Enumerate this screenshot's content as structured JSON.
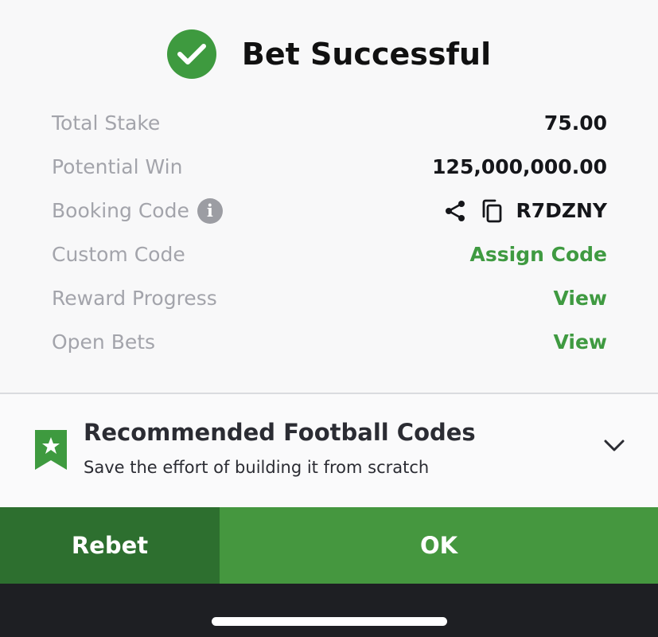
{
  "header": {
    "title": "Bet Successful",
    "icon": "check-circle-icon",
    "icon_color": "#3e9a3f"
  },
  "details": {
    "total_stake_label": "Total Stake",
    "total_stake_value": "75.00",
    "potential_win_label": "Potential Win",
    "potential_win_value": "125,000,000.00",
    "booking_code_label": "Booking Code",
    "booking_code_info_icon": "info-icon",
    "booking_code_value": "R7DZNY",
    "custom_code_label": "Custom Code",
    "custom_code_action": "Assign Code",
    "reward_progress_label": "Reward Progress",
    "reward_progress_action": "View",
    "open_bets_label": "Open Bets",
    "open_bets_action": "View"
  },
  "recommend": {
    "icon": "bookmark-star-icon",
    "title": "Recommended Football Codes",
    "subtitle": "Save the effort of building it from scratch"
  },
  "buttons": {
    "rebet_label": "Rebet",
    "ok_label": "OK"
  },
  "colors": {
    "accent_green": "#3f9a41",
    "rebet_bg": "#2d6f2f",
    "ok_bg": "#45973f"
  }
}
